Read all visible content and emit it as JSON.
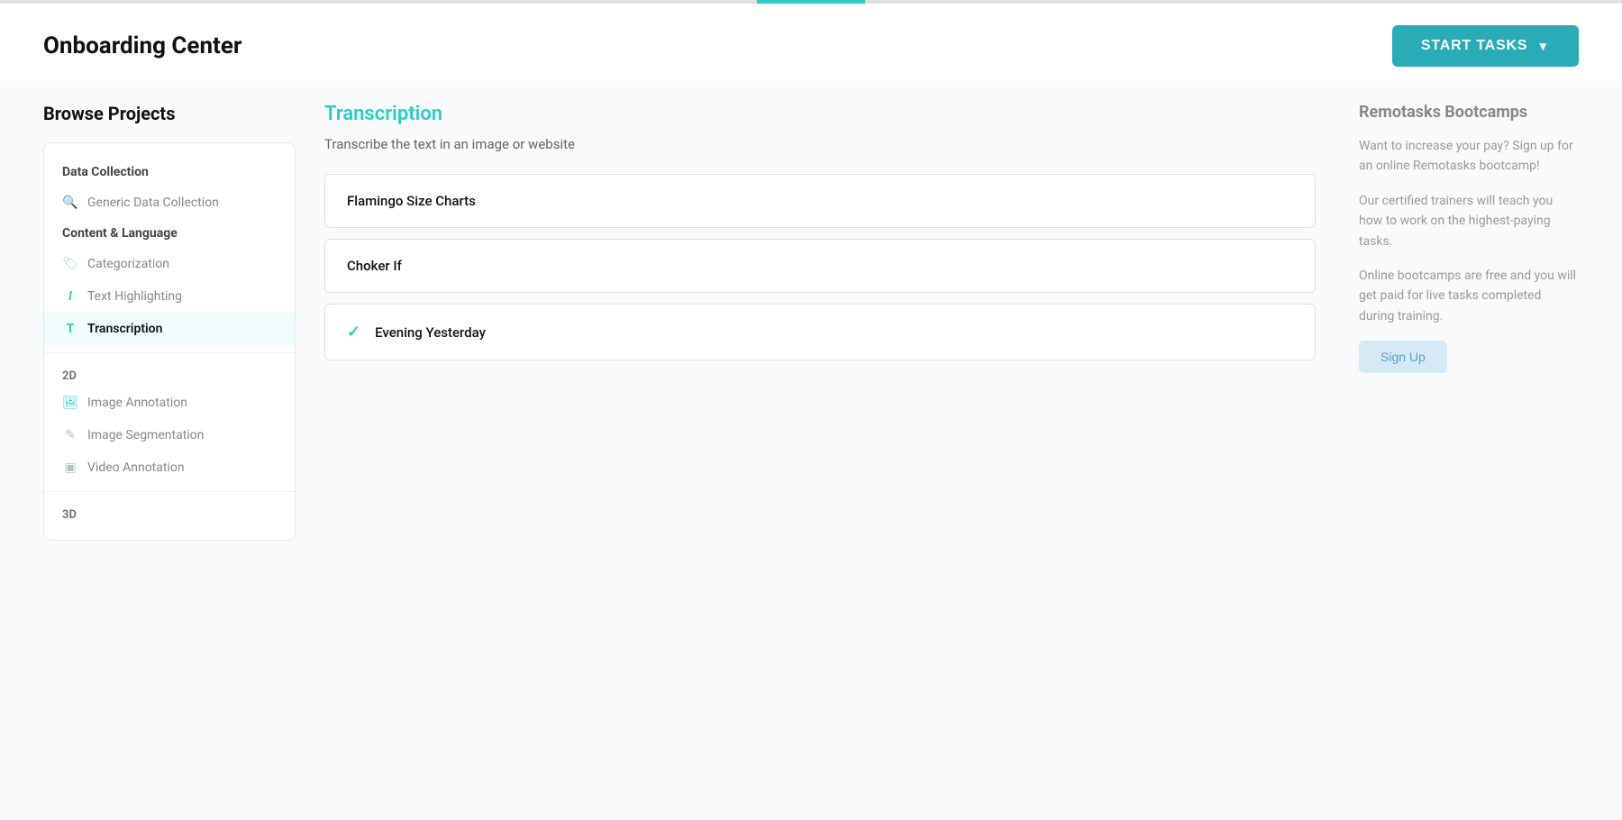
{
  "topBar": {
    "progressWidth": "120px"
  },
  "header": {
    "title": "Onboarding Center",
    "startTasksLabel": "START TASKS"
  },
  "browse": {
    "title": "Browse Projects"
  },
  "sidebar": {
    "sections": [
      {
        "label": "Data Collection",
        "type": "section"
      },
      {
        "label": "Generic Data Collection",
        "icon": "search",
        "iconType": "gray",
        "type": "item"
      },
      {
        "label": "Content & Language",
        "type": "section"
      },
      {
        "label": "Categorization",
        "icon": "tag",
        "iconType": "gray",
        "type": "item"
      },
      {
        "label": "Text Highlighting",
        "icon": "I",
        "iconType": "teal",
        "type": "item"
      },
      {
        "label": "Transcription",
        "icon": "T",
        "iconType": "teal",
        "type": "item",
        "active": true
      }
    ],
    "sections2D": {
      "label": "2D",
      "items": [
        {
          "label": "Image Annotation",
          "icon": "image",
          "iconType": "teal"
        },
        {
          "label": "Image Segmentation",
          "icon": "pencil",
          "iconType": "gray"
        },
        {
          "label": "Video Annotation",
          "icon": "film",
          "iconType": "gray"
        }
      ]
    },
    "sections3D": {
      "label": "3D"
    }
  },
  "transcription": {
    "title": "Transcription",
    "subtitle": "Transcribe the text in an image or website",
    "tasks": [
      {
        "id": 1,
        "label": "Flamingo Size Charts",
        "checked": false
      },
      {
        "id": 2,
        "label": "Choker If",
        "checked": false
      },
      {
        "id": 3,
        "label": "Evening Yesterday",
        "checked": true
      }
    ]
  },
  "bootcamp": {
    "title": "Remotasks Bootcamps",
    "paragraphs": [
      "Want to increase your pay? Sign up for an online Remotasks bootcamp!",
      "Our certified trainers will teach you how to work on the highest-paying tasks.",
      "Online bootcamps are free and you will get paid for live tasks completed during training."
    ],
    "signUpLabel": "Sign Up"
  }
}
